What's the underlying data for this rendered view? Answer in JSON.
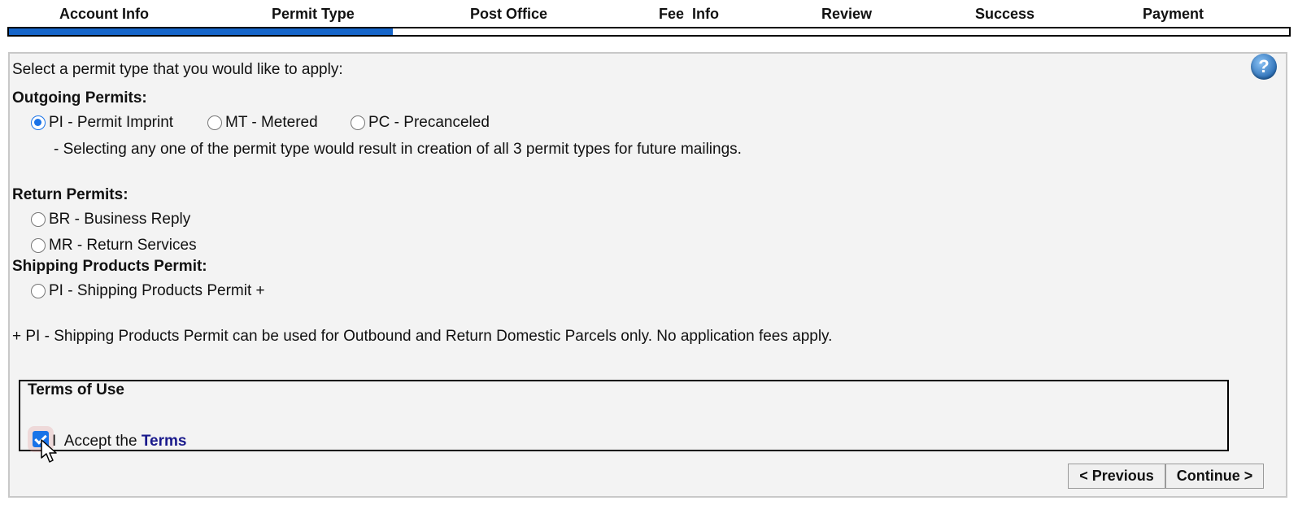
{
  "steps": [
    "Account Info",
    "Permit Type",
    "Post Office",
    "Fee  Info",
    "Review",
    "Success",
    "Payment"
  ],
  "progress": {
    "current_step": 2,
    "total_steps": 7,
    "fill_fraction": 0.3,
    "color": "#1565c9"
  },
  "help_icon": {
    "name": "help-icon",
    "glyph": "?"
  },
  "intro": "Select a permit type that you would like to apply:",
  "outgoing": {
    "heading": "Outgoing Permits:",
    "options": [
      {
        "label": "PI - Permit Imprint",
        "checked": true
      },
      {
        "label": "MT - Metered",
        "checked": false
      },
      {
        "label": "PC - Precanceled",
        "checked": false
      }
    ],
    "note": "- Selecting any one of the permit type would result in creation of all 3 permit types for future mailings."
  },
  "return": {
    "heading": "Return Permits:",
    "options": [
      {
        "label": "BR - Business Reply",
        "checked": false
      },
      {
        "label": "MR - Return Services",
        "checked": false
      }
    ]
  },
  "shipping": {
    "heading": "Shipping Products Permit:",
    "options": [
      {
        "label": "PI - Shipping Products Permit +",
        "checked": false
      }
    ],
    "footnote": "+ PI - Shipping Products Permit can be used for Outbound and Return Domestic Parcels only. No application fees apply."
  },
  "terms": {
    "heading": "Terms of Use",
    "accept_prefix": "I  Accept the ",
    "link_text": "Terms",
    "accepted": true
  },
  "buttons": {
    "previous": "< Previous",
    "continue": "Continue >"
  }
}
